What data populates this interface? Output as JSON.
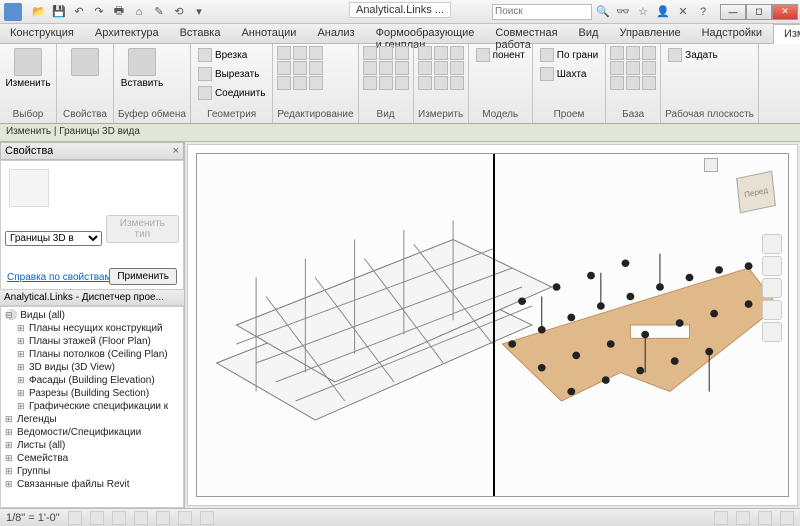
{
  "title": "Analytical.Links ...",
  "search_placeholder": "Поиск",
  "tabs": [
    "Конструкция",
    "Архитектура",
    "Вставка",
    "Аннотации",
    "Анализ",
    "Формообразующие и генплан",
    "Совместная работа",
    "Вид",
    "Управление",
    "Надстройки",
    "Изменить"
  ],
  "active_tab": 10,
  "ribbon": {
    "groups": [
      {
        "label": "Выбор",
        "items": [
          {
            "label": "Изменить",
            "big": true
          }
        ]
      },
      {
        "label": "Свойства",
        "items": [
          {
            "label": "",
            "big": true
          }
        ]
      },
      {
        "label": "Буфер обмена",
        "items": [
          {
            "label": "Вставить",
            "big": true
          }
        ]
      },
      {
        "label": "Геометрия",
        "items": [
          {
            "label": "Врезка"
          },
          {
            "label": "Вырезать"
          },
          {
            "label": "Соединить"
          }
        ]
      },
      {
        "label": "Редактирование",
        "items": []
      },
      {
        "label": "Вид",
        "items": []
      },
      {
        "label": "Измерить",
        "items": []
      },
      {
        "label": "Модель",
        "items": [
          {
            "label": "понент"
          }
        ]
      },
      {
        "label": "Проем",
        "items": [
          {
            "label": "По грани"
          },
          {
            "label": "Шахта"
          }
        ]
      },
      {
        "label": "База",
        "items": []
      },
      {
        "label": "Рабочая плоскость",
        "items": [
          {
            "label": "Задать"
          }
        ]
      }
    ]
  },
  "breadcrumb": "Изменить | Границы 3D вида",
  "properties": {
    "title": "Свойства",
    "combo": "Границы 3D в",
    "change_type": "Изменить тип",
    "help_link": "Справка по свойствам",
    "apply": "Применить"
  },
  "browser": {
    "title": "Analytical.Links - Диспетчер прое...",
    "root": "Виды (all)",
    "items": [
      "Планы несущих конструкций",
      "Планы этажей (Floor Plan)",
      "Планы потолков (Ceiling Plan)",
      "3D виды (3D View)",
      "Фасады (Building Elevation)",
      "Разрезы (Building Section)",
      "Графические спецификации к"
    ],
    "extra": [
      "Легенды",
      "Ведомости/Спецификации",
      "Листы (all)",
      "Семейства",
      "Группы",
      "Связанные файлы Revit"
    ]
  },
  "status": {
    "scale": "1/8\" = 1'-0\"",
    "items": [
      "",
      "",
      "",
      "",
      "",
      "",
      ""
    ]
  },
  "viewcube_label": "Перед",
  "colors": {
    "accent": "#8bb0dd",
    "analytical_surface": "#e0b98a"
  }
}
